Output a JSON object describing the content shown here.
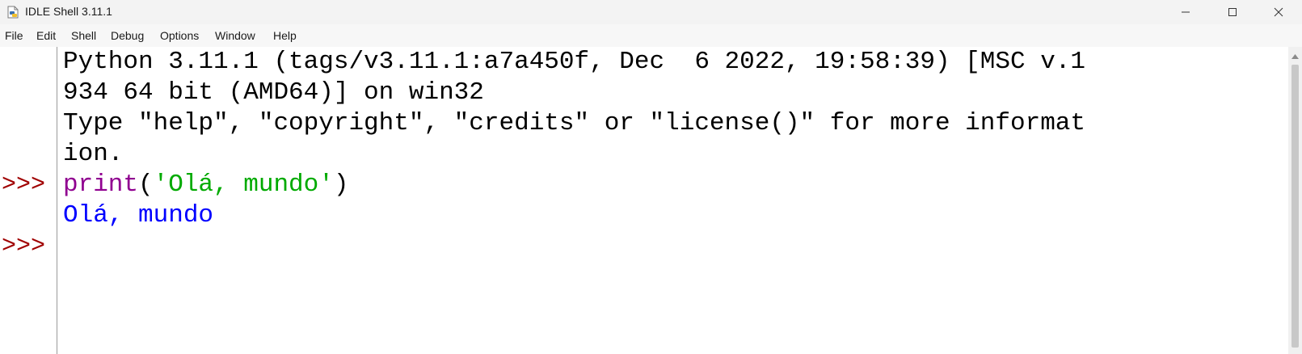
{
  "window": {
    "title": "IDLE Shell 3.11.1",
    "icon": "python-file-icon"
  },
  "menu": [
    "File",
    "Edit",
    "Shell",
    "Debug",
    "Options",
    "Window",
    "Help"
  ],
  "shell": {
    "banner_lines": [
      "Python 3.11.1 (tags/v3.11.1:a7a450f, Dec  6 2022, 19:58:39) [MSC v.1",
      "934 64 bit (AMD64)] on win32",
      "Type \"help\", \"copyright\", \"credits\" or \"license()\" for more informat",
      "ion."
    ],
    "prompt": ">>>",
    "input": {
      "builtin": "print",
      "open_paren": "(",
      "string": "'Olá, mundo'",
      "close_paren": ")"
    },
    "output": "Olá, mundo"
  },
  "colors": {
    "prompt": "#a00000",
    "builtin": "#900090",
    "string": "#00aa00",
    "stdout": "#0000ff",
    "text": "#000000"
  }
}
